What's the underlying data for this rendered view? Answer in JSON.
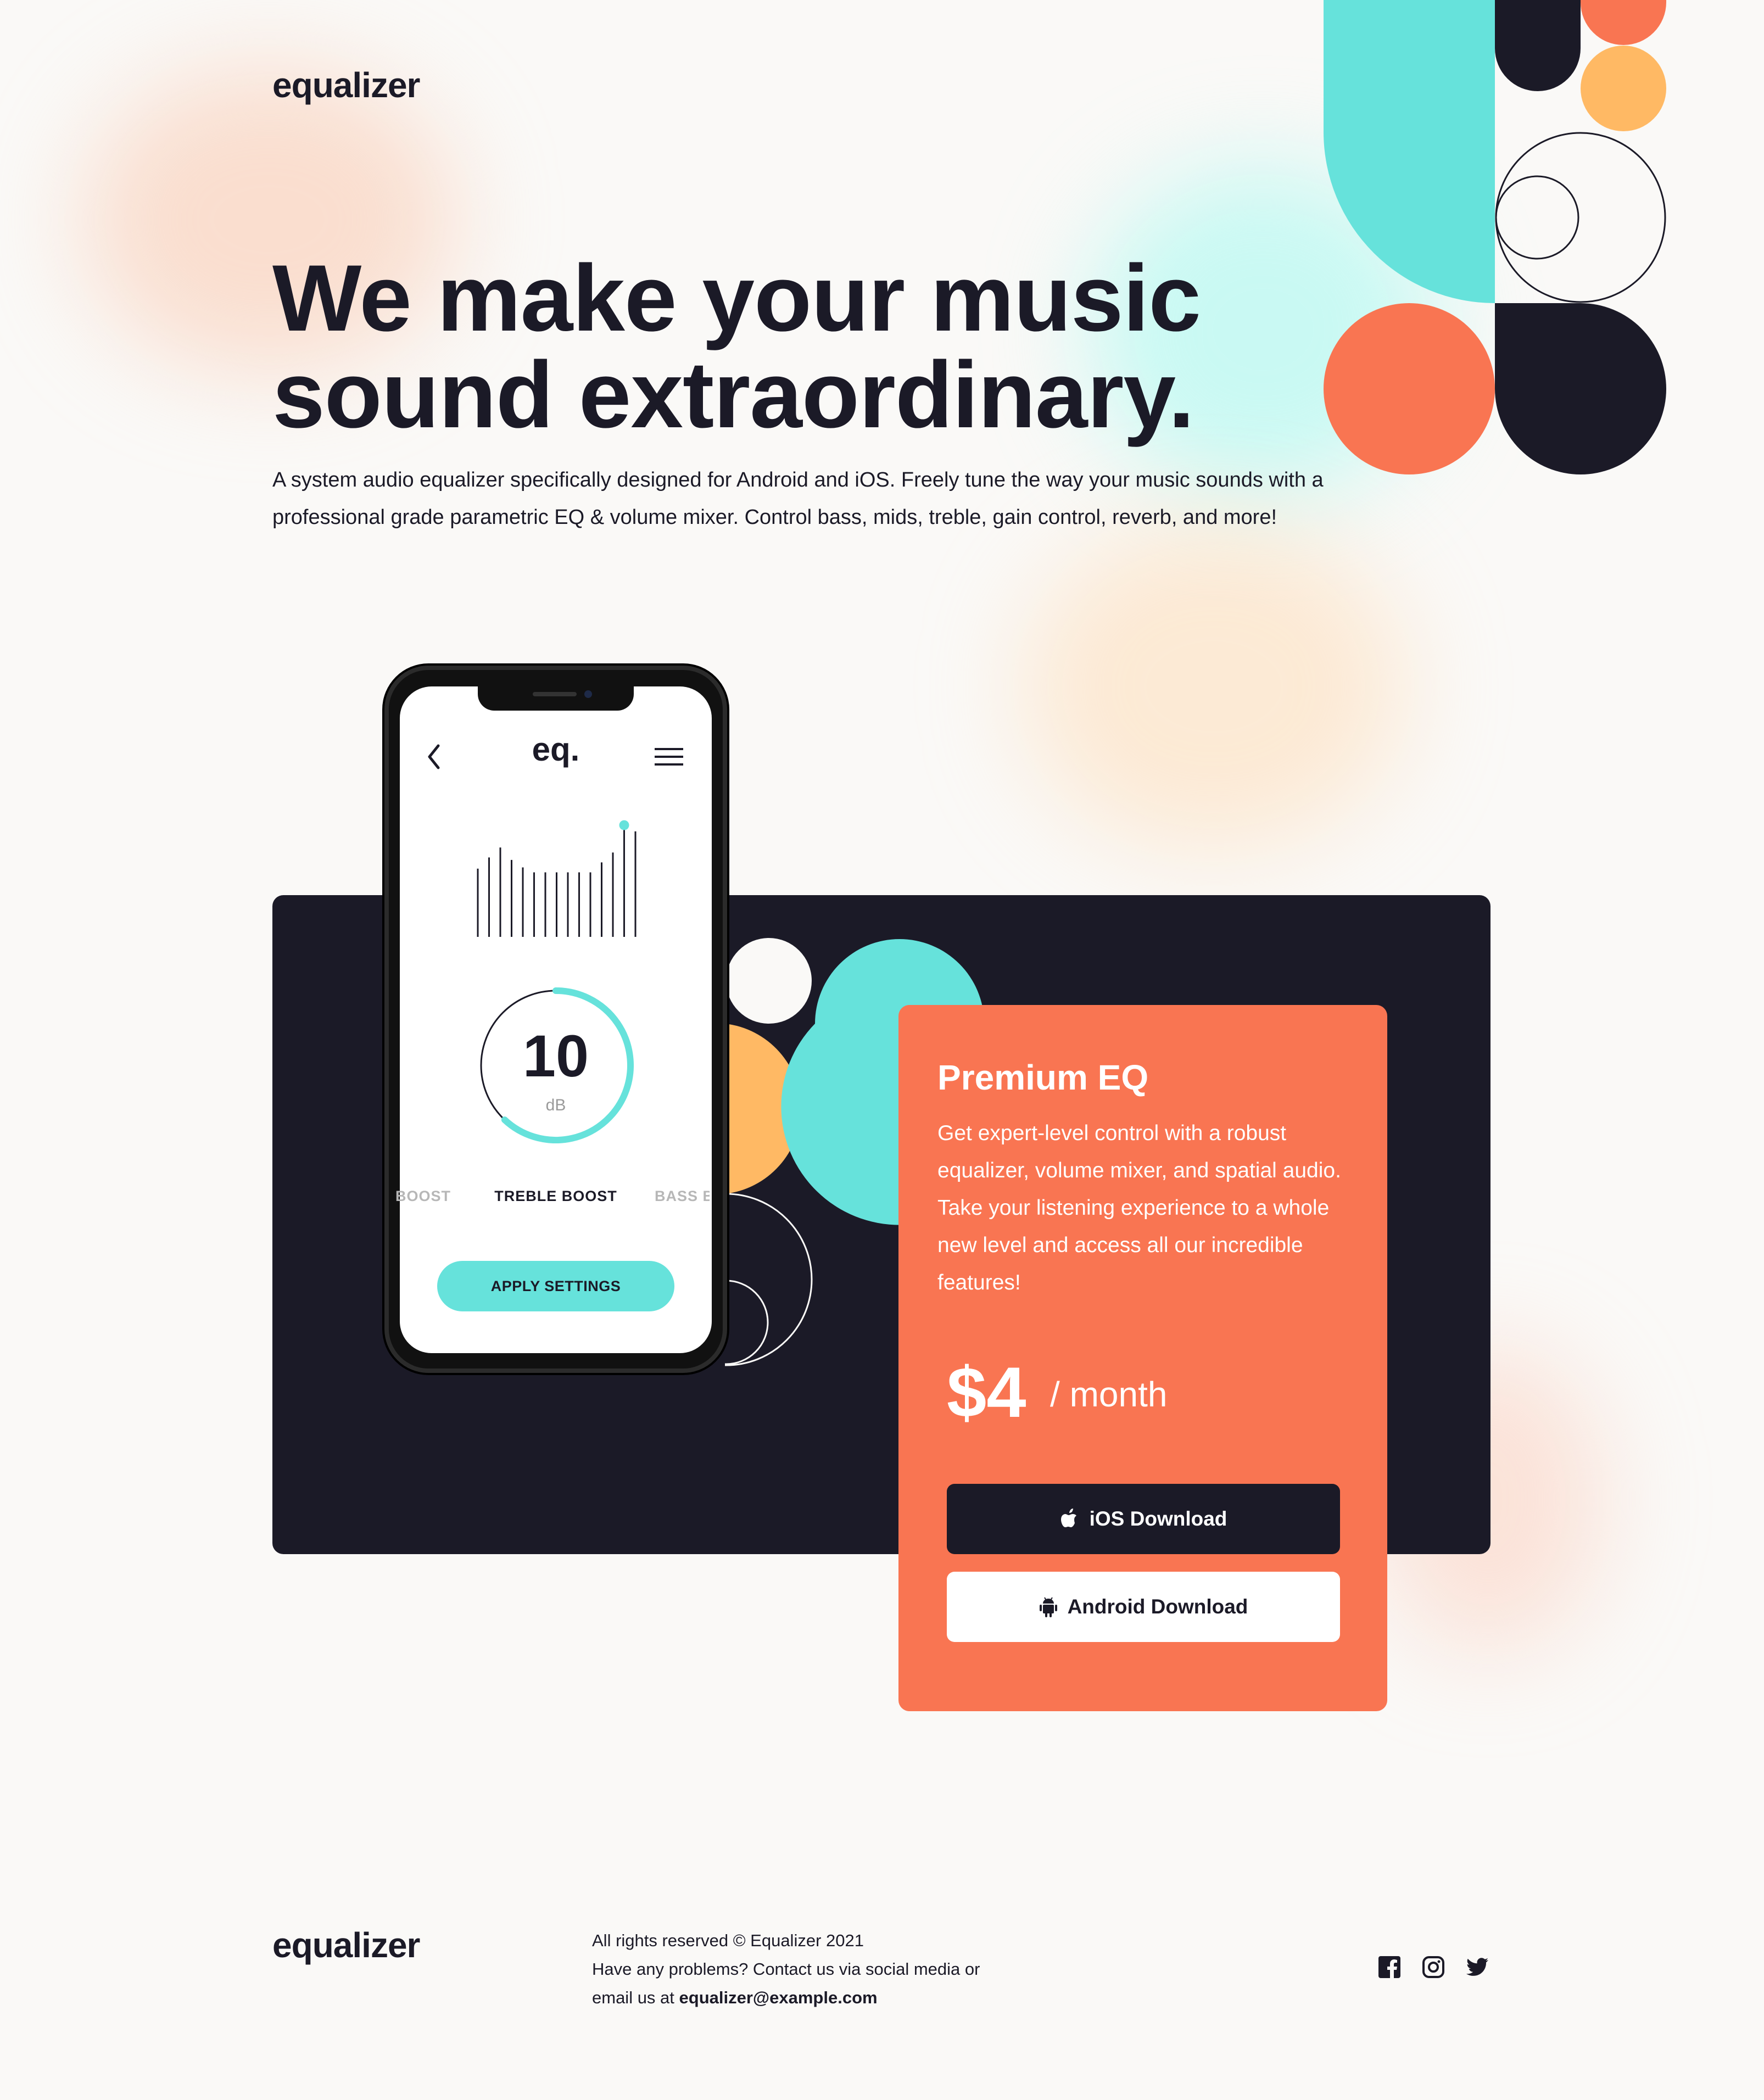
{
  "brand": {
    "logo": "equalizer",
    "colors": {
      "dark": "#1b1a27",
      "coral": "#f97552",
      "teal": "#66e2db",
      "orange": "#ffb964",
      "background": "#faf9f7"
    }
  },
  "hero": {
    "title_line1": "We make your music",
    "title_line2": "sound extraordinary.",
    "description": "A system audio equalizer specifically designed for Android and iOS. Freely tune the way your music sounds with a professional grade parametric EQ & volume mixer. Control bass, mids, treble, gain control, reverb, and more!"
  },
  "phone_app": {
    "logo": "eq.",
    "back_icon": "chevron-left-icon",
    "menu_icon": "hamburger-menu-icon",
    "equalizer_levels": [
      0.55,
      0.64,
      0.72,
      0.62,
      0.56,
      0.52,
      0.52,
      0.52,
      0.52,
      0.52,
      0.52,
      0.6,
      0.68,
      0.9,
      0.85
    ],
    "db_value": "10",
    "db_unit": "dB",
    "dial_progress": 0.62,
    "mode_left": "BOOST",
    "mode_center": "TREBLE BOOST",
    "mode_right": "BASS B",
    "apply_button": "APPLY SETTINGS"
  },
  "premium": {
    "title": "Premium EQ",
    "description": "Get expert-level control with a robust equalizer, volume mixer, and spatial audio. Take your listening experience to a whole new level and access all our incredible features!",
    "price": "$4",
    "period": "/ month",
    "ios_button": "iOS Download",
    "ios_icon": "apple-icon",
    "android_button": "Android Download",
    "android_icon": "android-icon"
  },
  "footer": {
    "logo": "equalizer",
    "copyright": "All rights reserved © Equalizer 2021",
    "contact": "Have any problems? Contact us via social media or",
    "email_prefix": "email us at",
    "email": "equalizer@example.com",
    "socials": [
      "facebook-icon",
      "instagram-icon",
      "twitter-icon"
    ]
  }
}
